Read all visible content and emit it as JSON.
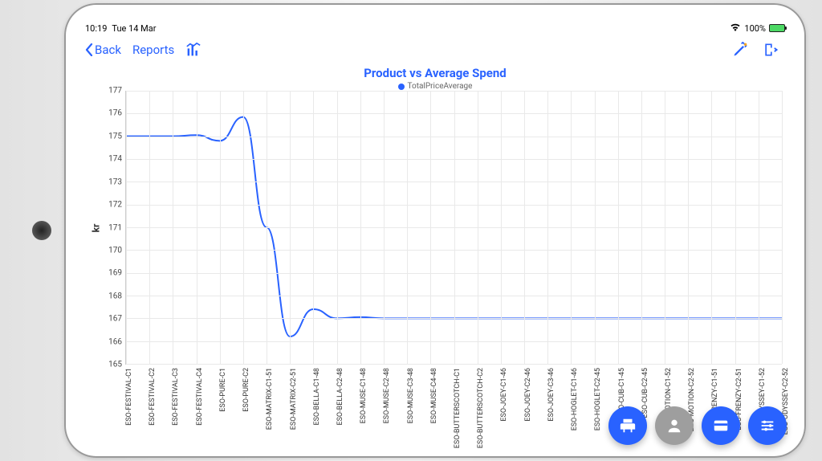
{
  "status": {
    "time": "10:19",
    "date": "Tue 14 Mar",
    "battery_pct": "100%"
  },
  "nav": {
    "back_label": "Back",
    "reports_label": "Reports"
  },
  "chart_data": {
    "type": "line",
    "title": "Product vs Average Spend",
    "xlabel": "",
    "ylabel": "kr",
    "ylim": [
      165,
      177
    ],
    "yticks": [
      165,
      166,
      167,
      168,
      169,
      170,
      171,
      172,
      173,
      174,
      175,
      176,
      177
    ],
    "series": [
      {
        "name": "TotalPriceAverage",
        "color": "#2962ff"
      }
    ],
    "categories": [
      "ESO-FESTIVAL-C1",
      "ESO-FESTIVAL-C2",
      "ESO-FESTIVAL-C3",
      "ESO-FESTIVAL-C4",
      "ESO-PURE-C1",
      "ESO-PURE-C2",
      "ESO-MATRIX-C1-51",
      "ESO-MATRIX-C2-51",
      "ESO-BELLA-C1-48",
      "ESO-BELLA-C2-48",
      "ESO-MUSE-C1-48",
      "ESO-MUSE-C2-48",
      "ESO-MUSE-C3-48",
      "ESO-MUSE-C4-48",
      "ESO-BUTTERSCOTCH-C1",
      "ESO-BUTTERSCOTCH-C2",
      "ESO-JOEY-C1-46",
      "ESO-JOEY-C2-46",
      "ESO-JOEY-C3-46",
      "ESO-HOGLET-C1-46",
      "ESO-HOGLET-C2-45",
      "ESO-CUB-C1-45",
      "ESO-CUB-C2-45",
      "ESO-MOTION-C1-52",
      "ESO-MOTION-C2-52",
      "ESO-FRENZY-C1-51",
      "ESO-FRENZY-C2-51",
      "ESO-ODYSSEY-C1-52",
      "ESO-ODYSSEY-C2-52"
    ],
    "values": [
      175.0,
      175.0,
      175.0,
      175.05,
      174.8,
      175.85,
      171.0,
      166.2,
      167.4,
      167.0,
      167.05,
      167.0,
      167.0,
      167.0,
      167.0,
      167.0,
      167.0,
      167.0,
      167.0,
      167.0,
      167.0,
      167.0,
      167.0,
      167.0,
      167.0,
      167.0,
      167.0,
      167.0,
      167.0
    ]
  }
}
